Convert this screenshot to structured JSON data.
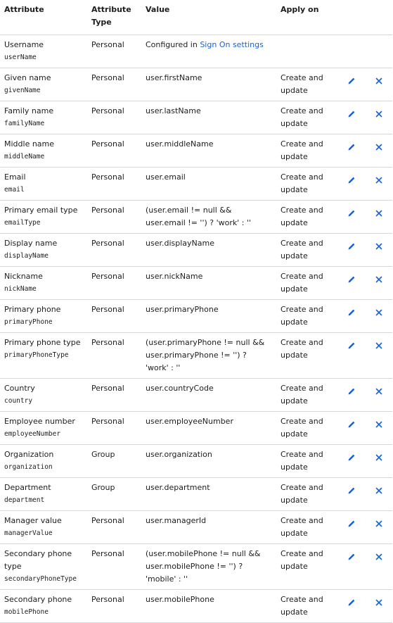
{
  "headers": {
    "attribute": "Attribute",
    "attribute_type": "Attribute Type",
    "value": "Value",
    "apply_on": "Apply on"
  },
  "first_row": {
    "name": "Username",
    "var": "userName",
    "type": "Personal",
    "value_prefix": "Configured in ",
    "value_link": "Sign On settings"
  },
  "rows": [
    {
      "name": "Given name",
      "var": "givenName",
      "type": "Personal",
      "value": "user.firstName",
      "apply": "Create and update"
    },
    {
      "name": "Family name",
      "var": "familyName",
      "type": "Personal",
      "value": "user.lastName",
      "apply": "Create and update"
    },
    {
      "name": "Middle name",
      "var": "middleName",
      "type": "Personal",
      "value": "user.middleName",
      "apply": "Create and update"
    },
    {
      "name": "Email",
      "var": "email",
      "type": "Personal",
      "value": "user.email",
      "apply": "Create and update"
    },
    {
      "name": "Primary email type",
      "var": "emailType",
      "type": "Personal",
      "value": "(user.email != null && user.email != '') ? 'work' : ''",
      "apply": "Create and update"
    },
    {
      "name": "Display name",
      "var": "displayName",
      "type": "Personal",
      "value": "user.displayName",
      "apply": "Create and update"
    },
    {
      "name": "Nickname",
      "var": "nickName",
      "type": "Personal",
      "value": "user.nickName",
      "apply": "Create and update"
    },
    {
      "name": "Primary phone",
      "var": "primaryPhone",
      "type": "Personal",
      "value": "user.primaryPhone",
      "apply": "Create and update"
    },
    {
      "name": "Primary phone type",
      "var": "primaryPhoneType",
      "type": "Personal",
      "value": "(user.primaryPhone != null && user.primaryPhone != '') ? 'work' : ''",
      "apply": "Create and update"
    },
    {
      "name": "Country",
      "var": "country",
      "type": "Personal",
      "value": "user.countryCode",
      "apply": "Create and update"
    },
    {
      "name": "Employee number",
      "var": "employeeNumber",
      "type": "Personal",
      "value": "user.employeeNumber",
      "apply": "Create and update"
    },
    {
      "name": "Organization",
      "var": "organization",
      "type": "Group",
      "value": "user.organization",
      "apply": "Create and update"
    },
    {
      "name": "Department",
      "var": "department",
      "type": "Group",
      "value": "user.department",
      "apply": "Create and update"
    },
    {
      "name": "Manager value",
      "var": "managerValue",
      "type": "Personal",
      "value": "user.managerId",
      "apply": "Create and update"
    },
    {
      "name": "Secondary phone type",
      "var": "secondaryPhoneType",
      "type": "Personal",
      "value": "(user.mobilePhone != null && user.mobilePhone != '') ? 'mobile' : ''",
      "apply": "Create and update"
    },
    {
      "name": "Secondary phone",
      "var": "mobilePhone",
      "type": "Personal",
      "value": "user.mobilePhone",
      "apply": "Create and update"
    }
  ],
  "icons": {
    "edit": "pencil-icon",
    "delete": "close-icon",
    "accent": "#1662dd"
  }
}
